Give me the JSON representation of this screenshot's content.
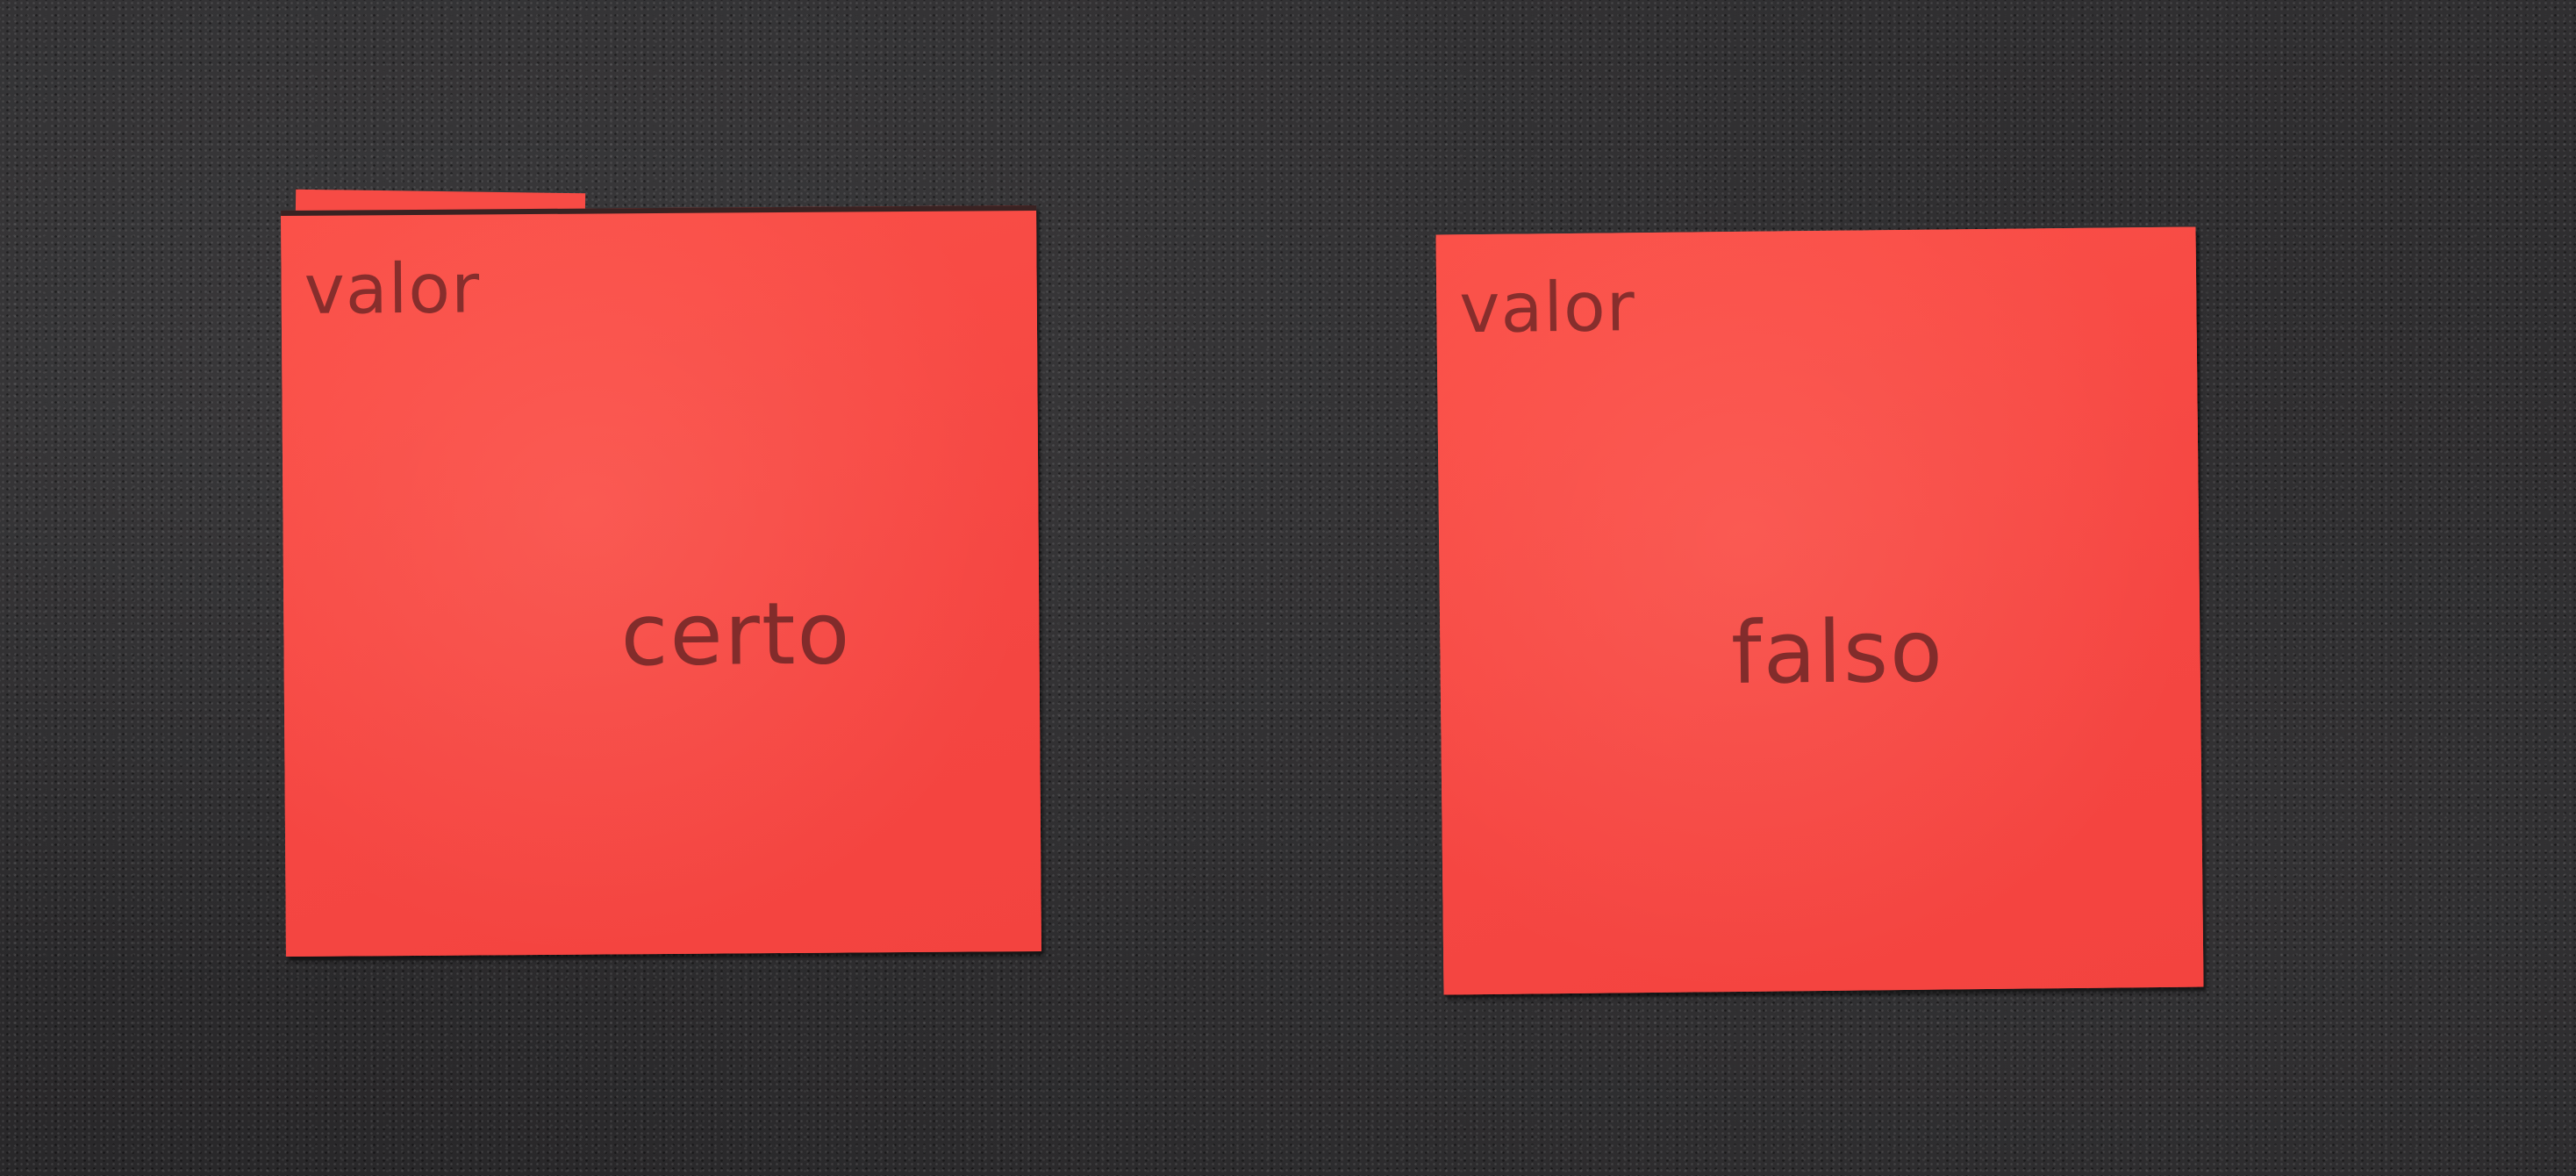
{
  "background": {
    "surface_color": "#2a292b",
    "card_color": "#f74b45",
    "text_color": "#6e2626"
  },
  "cards": [
    {
      "label": "valor",
      "value": "certo"
    },
    {
      "label": "valor",
      "value": "falso"
    }
  ]
}
